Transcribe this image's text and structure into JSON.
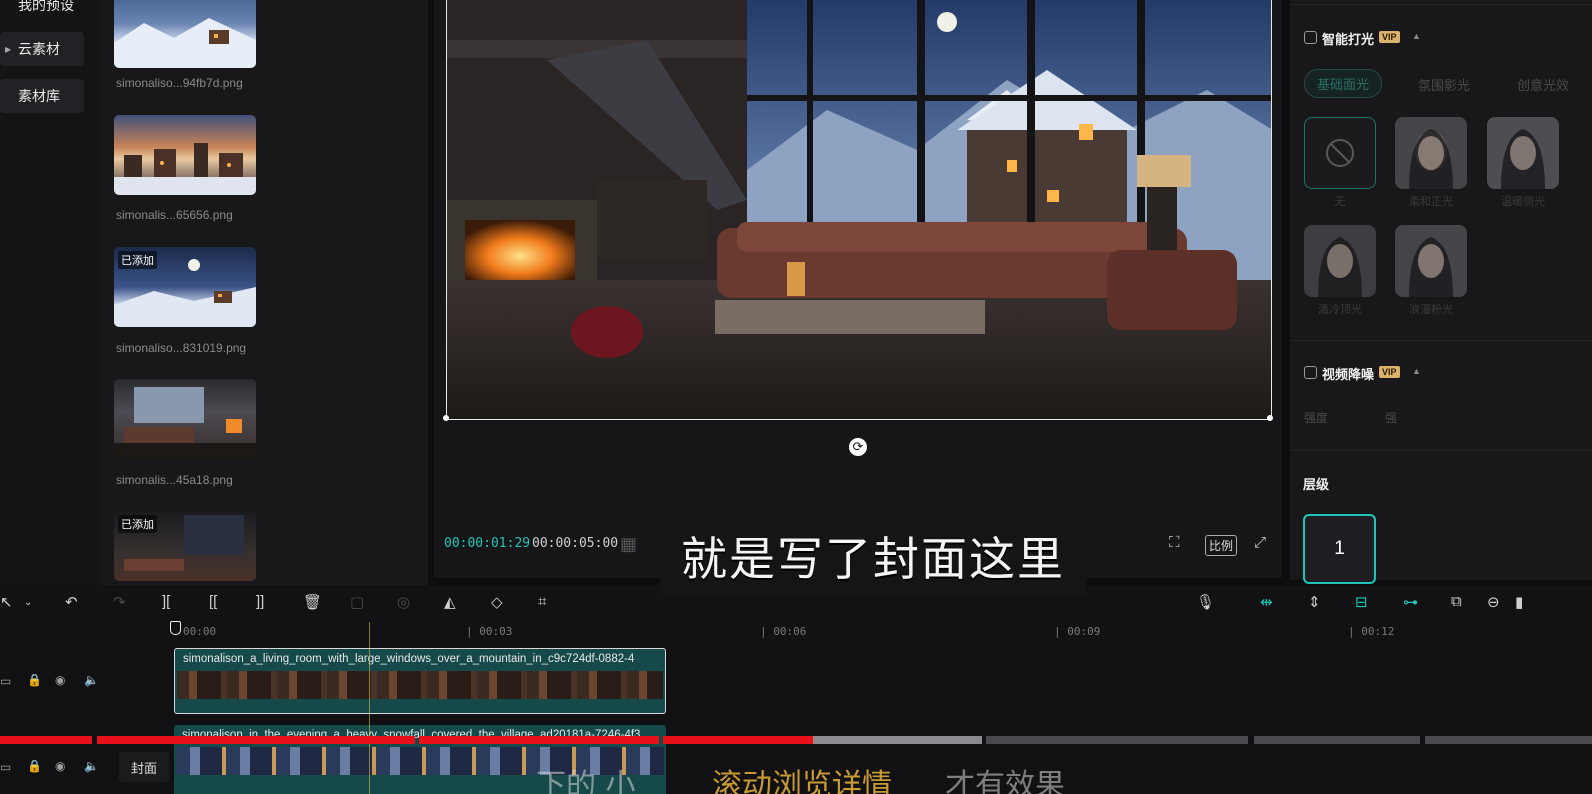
{
  "left_nav": {
    "items": [
      {
        "label": "我的预设"
      },
      {
        "label": "云素材"
      },
      {
        "label": "素材库"
      }
    ]
  },
  "assets": {
    "items": [
      {
        "name": "simonaliso...94fb7d.png",
        "tag": ""
      },
      {
        "name": "simonalis...65656.png",
        "tag": ""
      },
      {
        "name": "simonaliso...831019.png",
        "tag": "已添加"
      },
      {
        "name": "simonalis...45a18.png",
        "tag": ""
      },
      {
        "name": "",
        "tag": "已添加"
      }
    ]
  },
  "player": {
    "current_time": "00:00:01:29",
    "total_time": "00:00:05:00",
    "ratio_label": "比例"
  },
  "subtitle": "就是写了封面这里",
  "right_panel": {
    "smart_light": {
      "title": "智能打光",
      "vip": "VIP"
    },
    "light_tabs": [
      "基础面光",
      "氛围影光",
      "创意光效"
    ],
    "light_presets": [
      "无",
      "柔和正光",
      "温暖侧光",
      "清冷顶光",
      "浪漫粉光"
    ],
    "video_denoise": {
      "title": "视频降噪",
      "vip": "VIP"
    },
    "strength_label": "强度",
    "strength_value": "强",
    "layer": {
      "title": "层级",
      "value": "1"
    }
  },
  "timeline": {
    "ruler_ticks": [
      "00:00",
      "| 00:03",
      "| 00:06",
      "| 00:09",
      "| 00:12"
    ],
    "clip1_name": "simonalison_a_living_room_with_large_windows_over_a_mountain_in_c9c724df-0882-4",
    "clip2_name": "simonalison_in_the_evening_a_heavy_snowfall_covered_the_village_ad20181a-7246-4f3",
    "cover_label": "封面"
  },
  "overlay": {
    "text_left": "下的 小",
    "text_mid": "滚动浏览详情",
    "text_right": "才有效果"
  }
}
